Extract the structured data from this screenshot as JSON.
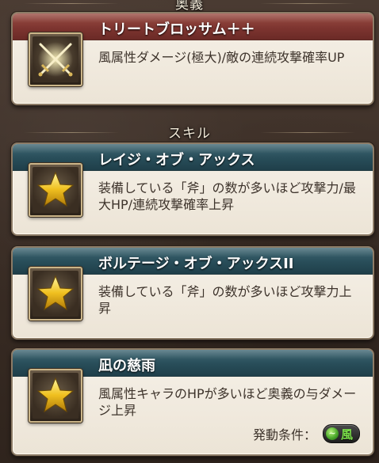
{
  "sections": {
    "ougi_title": "奥義",
    "skill_title": "スキル"
  },
  "ougi": {
    "name": "トリートブロッサム＋＋",
    "description": "風属性ダメージ(極大)/敵の連続攻撃確率UP",
    "icon": "crossed-swords-icon"
  },
  "skills": [
    {
      "name": "レイジ・オブ・アックス",
      "description": "装備している「斧」の数が多いほど攻撃力/最大HP/連続攻撃確率上昇",
      "icon": "star-icon"
    },
    {
      "name": "ボルテージ・オブ・アックスII",
      "description": "装備している「斧」の数が多いほど攻撃力上昇",
      "icon": "star-icon"
    },
    {
      "name": "凪の慈雨",
      "description": "風属性キャラのHPが多いほど奥義の与ダメージ上昇",
      "icon": "star-icon",
      "condition_label": "発動条件：",
      "condition_element": "風",
      "condition_element_color": "#7be04a"
    }
  ],
  "colors": {
    "ougi_header": "#7e3530",
    "skill_header": "#284d59",
    "card_bg": "#f3ede2",
    "text": "#3d332b"
  }
}
